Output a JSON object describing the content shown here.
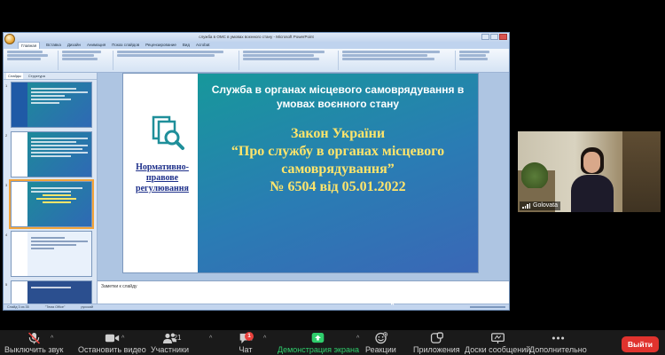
{
  "ppt": {
    "window_title": "служба в ОМС в умовах воєнного стану - Microsoft PowerPoint",
    "ribbon_tabs": [
      "Главная",
      "Вставка",
      "Дизайн",
      "Анимация",
      "Показ слайдов",
      "Рецензирование",
      "Вид",
      "Acrobat"
    ],
    "thumb_tabs": [
      "Слайды",
      "Структура"
    ],
    "notes_placeholder": "Заметки к слайду",
    "status": {
      "slide": "Слайд 3 из 35",
      "theme": "\"Тема Office\"",
      "lang": "русский"
    },
    "thumb_numbers": [
      "1",
      "2",
      "3",
      "4",
      "5"
    ],
    "slide": {
      "heading": "Служба в органах місцевого самоврядування в умовах воєнного стану",
      "law_title": "Закон України",
      "law_name": "“Про службу в органах місцевого самоврядування”",
      "law_number": "№ 6504 від 05.01.2022",
      "left_label": "Нормативно-правове регулювання",
      "icon": "document-magnifier-icon",
      "colors": {
        "gradient_start": "#17989b",
        "gradient_end": "#3a67b6",
        "law_text": "#ffe56b",
        "left_label": "#1d2f8a"
      }
    }
  },
  "participant": {
    "name": "Golovata"
  },
  "toolbar": {
    "mute": "Выключить звук",
    "video": "Остановить видео",
    "participants": "Участники",
    "participants_count": "21",
    "chat": "Чат",
    "chat_badge": "1",
    "share": "Демонстрация экрана",
    "reactions": "Реакции",
    "apps": "Приложения",
    "whiteboards": "Доски сообщений",
    "more": "Дополнительно",
    "leave": "Выйти",
    "colors": {
      "leave": "#e0332e",
      "share": "#2fce6c"
    }
  }
}
